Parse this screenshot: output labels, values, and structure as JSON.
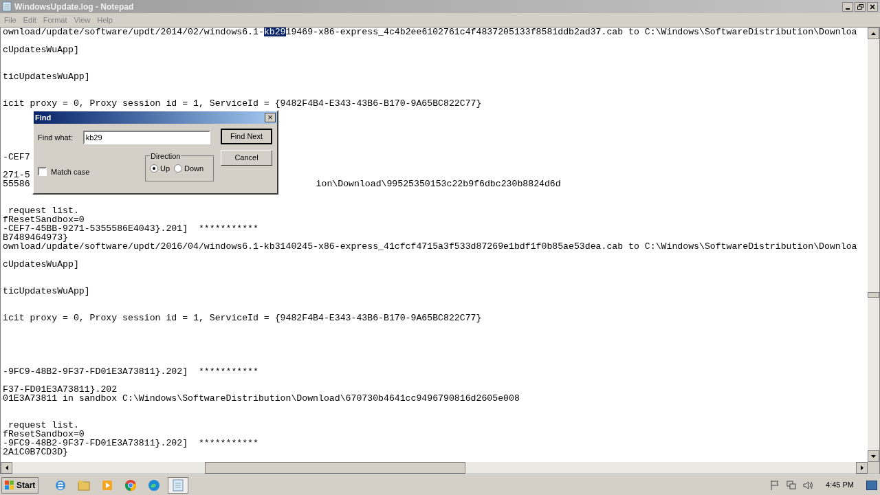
{
  "window": {
    "title": "WindowsUpdate.log - Notepad"
  },
  "menu": [
    "File",
    "Edit",
    "Format",
    "View",
    "Help"
  ],
  "lines": [
    {
      "text": "ownload/update/software/updt/2014/02/windows6.1-",
      "selected_text": "kb29",
      "text_after": "19469-x86-express_4c4b2ee6102761c4f4837205133f8581ddb2ad37.cab to C:\\Windows\\SoftwareDistribution\\Downloa"
    },
    {
      "text": "cUpdatesWuApp]"
    },
    {
      "text": "ticUpdatesWuApp]"
    },
    {
      "text": "icit proxy = 0, Proxy session id = 1, ServiceId = {9482F4B4-E343-43B6-B170-9A65BC822C77}"
    },
    {
      "text": "-CEF7"
    },
    {
      "text": "271-5"
    },
    {
      "text": "55586",
      "right_text": "ion\\Download\\99525350153c22b9f6dbc230b8824d6d"
    },
    {
      "text": " request list."
    },
    {
      "text": "fResetSandbox=0"
    },
    {
      "text": "-CEF7-45BB-9271-5355586E4043}.201]  ***********"
    },
    {
      "text": "B7489464973}"
    },
    {
      "text": "ownload/update/software/updt/2016/04/windows6.1-kb3140245-x86-express_41cfcf4715a3f533d87269e1bdf1f0b85ae53dea.cab to C:\\Windows\\SoftwareDistribution\\Downloa"
    },
    {
      "text": "cUpdatesWuApp]"
    },
    {
      "text": "ticUpdatesWuApp]"
    },
    {
      "text": "icit proxy = 0, Proxy session id = 1, ServiceId = {9482F4B4-E343-43B6-B170-9A65BC822C77}"
    },
    {
      "text": "-9FC9-48B2-9F37-FD01E3A73811}.202]  ***********"
    },
    {
      "text": "F37-FD01E3A73811}.202"
    },
    {
      "text": "01E3A73811 in sandbox C:\\Windows\\SoftwareDistribution\\Download\\670730b4641cc9496790816d2605e008"
    },
    {
      "text": " request list."
    },
    {
      "text": "fResetSandbox=0"
    },
    {
      "text": "-9FC9-48B2-9F37-FD01E3A73811}.202]  ***********"
    },
    {
      "text": "2A1C0B7CD3D}"
    }
  ],
  "find_dialog": {
    "title": "Find",
    "close": "×",
    "find_what_label": "Find what:",
    "find_what_value": "kb29",
    "find_next": "Find Next",
    "cancel": "Cancel",
    "direction_label": "Direction",
    "directions": [
      {
        "label": "Up",
        "selected": true
      },
      {
        "label": "Down",
        "selected": false
      }
    ],
    "match_case": {
      "label": "Match case",
      "checked": false
    }
  },
  "taskbar": {
    "start": "Start",
    "apps": [
      {
        "kind": "ie",
        "active": false
      },
      {
        "kind": "folder",
        "active": false
      },
      {
        "kind": "media",
        "active": false
      },
      {
        "kind": "chrome",
        "active": false
      },
      {
        "kind": "edge",
        "active": false
      },
      {
        "kind": "notepad",
        "active": true
      }
    ],
    "time": "4:45 PM"
  }
}
